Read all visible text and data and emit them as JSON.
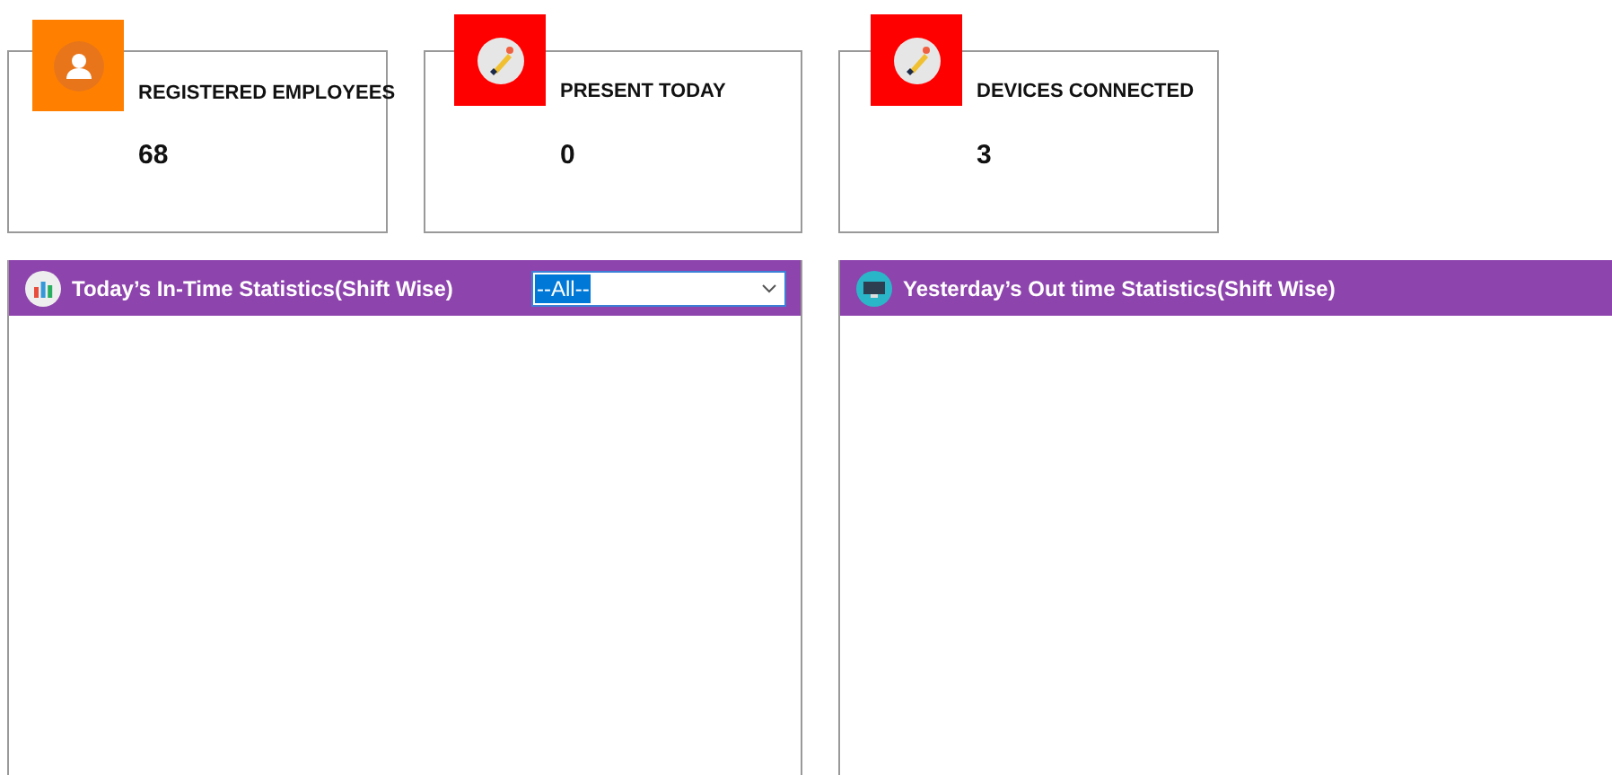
{
  "cards": [
    {
      "kind": "person",
      "color": "#ff8000",
      "label": "REGISTERED EMPLOYEES",
      "value": "68"
    },
    {
      "kind": "pen",
      "color": "#ff0000",
      "label": "PRESENT TODAY",
      "value": "0"
    },
    {
      "kind": "pen",
      "color": "#ff0000",
      "label": "DEVICES CONNECTED",
      "value": "3"
    }
  ],
  "panels": [
    {
      "kind": "chart",
      "title": "Today’s In-Time Statistics(Shift Wise)",
      "dropdown": {
        "value": "--All--"
      }
    },
    {
      "kind": "monitor",
      "title": "Yesterday’s Out time Statistics(Shift Wise)"
    }
  ]
}
